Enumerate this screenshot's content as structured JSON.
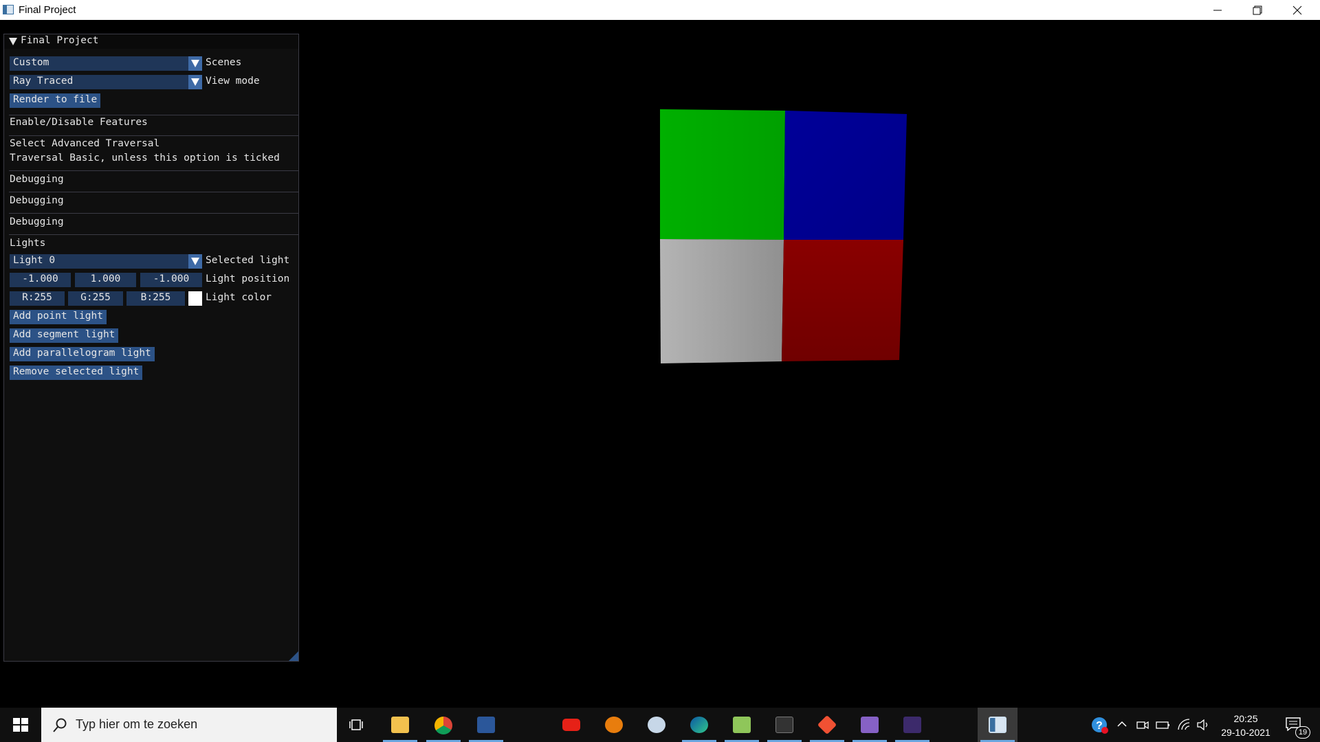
{
  "window": {
    "title": "Final Project"
  },
  "panel": {
    "header": "Final Project",
    "scenes": {
      "value": "Custom",
      "label": "Scenes"
    },
    "view_mode": {
      "value": "Ray Traced",
      "label": "View mode"
    },
    "render_button": "Render to file",
    "features_heading": "Enable/Disable Features",
    "traversal_title": "Select Advanced Traversal",
    "traversal_note": "Traversal Basic, unless this option is ticked",
    "debugging": [
      "Debugging",
      "Debugging",
      "Debugging"
    ],
    "lights_heading": "Lights",
    "selected_light": {
      "value": "Light 0",
      "label": "Selected light"
    },
    "light_position": {
      "values": [
        "-1.000",
        "1.000",
        "-1.000"
      ],
      "label": "Light position"
    },
    "light_color": {
      "values": [
        "R:255",
        "G:255",
        "B:255"
      ],
      "swatch": "#ffffff",
      "label": "Light color"
    },
    "buttons": [
      "Add point light",
      "Add segment light",
      "Add parallelogram light",
      "Remove selected light"
    ]
  },
  "scene": {
    "quad_colors": {
      "top_left": "#00aa00",
      "top_right": "#00008f",
      "bottom_left": "#a8a8a8",
      "bottom_right": "#7f0000"
    }
  },
  "taskbar": {
    "search_placeholder": "Typ hier om te zoeken",
    "apps": [
      "task-view",
      "file-explorer",
      "chrome",
      "word",
      "youtube",
      "blender",
      "paint",
      "edge",
      "notepad-plus",
      "terminal",
      "git",
      "visual-studio",
      "console",
      "final-project"
    ],
    "time": "20:25",
    "date": "29-10-2021",
    "notifications": "19",
    "accent": "#6aa7e0"
  }
}
